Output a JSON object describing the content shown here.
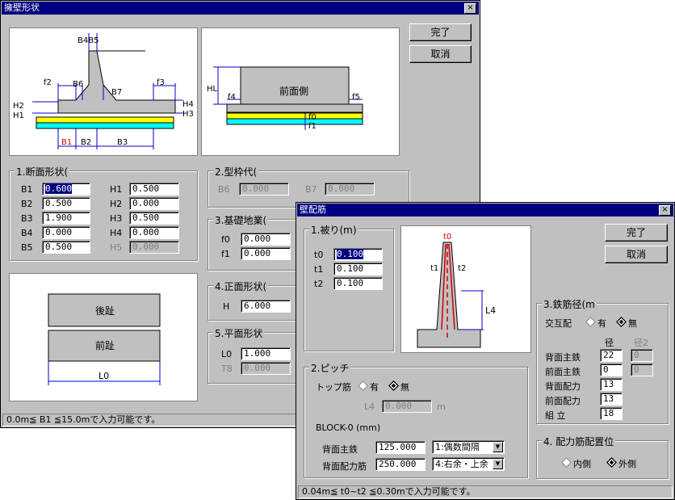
{
  "win1": {
    "title": "擁壁形状",
    "close": "×",
    "ok": "完了",
    "cancel": "取消",
    "diagram1": {
      "b4b5": "B4B5",
      "b6": "B6",
      "b7": "B7",
      "f2": "f2",
      "f3": "f3",
      "h2": "H2",
      "h1": "H1",
      "h4": "H4",
      "h3": "H3",
      "b1": "B1",
      "b2": "B2",
      "b3": "B3"
    },
    "diagram2": {
      "hl": "HL",
      "front": "前面側",
      "f4": "f4",
      "f5": "f5",
      "f0": "f0",
      "f1": "f1"
    },
    "g1": {
      "title": "1.断面形状(",
      "b1": {
        "label": "B1",
        "value": "0.600"
      },
      "h1": {
        "label": "H1",
        "value": "0.500"
      },
      "b2": {
        "label": "B2",
        "value": "0.500"
      },
      "h2": {
        "label": "H2",
        "value": "0.000"
      },
      "b3": {
        "label": "B3",
        "value": "1.900"
      },
      "h3": {
        "label": "H3",
        "value": "0.500"
      },
      "b4": {
        "label": "B4",
        "value": "0.000"
      },
      "h4": {
        "label": "H4",
        "value": "0.000"
      },
      "b5": {
        "label": "B5",
        "value": "0.500"
      },
      "h5": {
        "label": "H5",
        "value": "0.000"
      }
    },
    "g2": {
      "title": "2.型枠代(",
      "b6": {
        "label": "B6",
        "value": "0.000"
      },
      "b7": {
        "label": "B7",
        "value": "0.000"
      }
    },
    "g3": {
      "title": "3.基礎地業(",
      "f0": {
        "label": "f0",
        "value": "0.000"
      },
      "f1": {
        "label": "f1",
        "value": "0.000"
      }
    },
    "g4": {
      "title": "4.正面形状(",
      "h": {
        "label": "H",
        "value": "6.000"
      }
    },
    "g5": {
      "title": "5.平面形状",
      "l0": {
        "label": "L0",
        "value": "1.000"
      },
      "t8": {
        "label": "T8",
        "value": "0.000"
      }
    },
    "plan": {
      "back": "後趾",
      "front": "前趾",
      "l0": "L0"
    },
    "status": "0.0m≦ B1 ≦15.0mで入力可能です。"
  },
  "win2": {
    "title": "壁配筋",
    "close": "×",
    "ok": "完了",
    "cancel": "取消",
    "g1": {
      "title": "1.被り(m)",
      "t0": {
        "label": "t0",
        "value": "0.100"
      },
      "t1": {
        "label": "t1",
        "value": "0.100"
      },
      "t2": {
        "label": "t2",
        "value": "0.100"
      }
    },
    "diagram": {
      "t0": "t0",
      "t1": "t1",
      "t2": "t2",
      "l4": "L4"
    },
    "g2": {
      "title": "2.ピッチ",
      "top_bar": "トップ筋",
      "yes": "有",
      "no": "無",
      "l4": {
        "label": "L4",
        "value": "0.000",
        "unit": "m"
      },
      "block": "BLOCK-0 (mm)",
      "back_main": {
        "label": "背面主鉄",
        "value": "125.000",
        "option": "1:偶数間隔"
      },
      "back_dist": {
        "label": "背面配力筋",
        "value": "250.000",
        "option": "4:右余・上余"
      }
    },
    "g3": {
      "title": "3.鉄筋径(m",
      "alt": "交互配",
      "yes": "有",
      "no": "無",
      "col1": "径",
      "col2": "径2",
      "rows": [
        {
          "label": "背面主鉄",
          "v1": "22",
          "v2": "0"
        },
        {
          "label": "前面主鉄",
          "v1": "0",
          "v2": "0"
        },
        {
          "label": "背面配力",
          "v1": "13"
        },
        {
          "label": "前面配力",
          "v1": "13"
        },
        {
          "label": "組 立",
          "v1": "18"
        }
      ]
    },
    "g4": {
      "title": "4. 配力筋配置位",
      "inner": "内側",
      "outer": "外側"
    },
    "status": "0.04m≦ t0~t2 ≦0.30mで入力可能です。"
  },
  "colors": {
    "titlebar": "#000080",
    "face": "#c0c0c0",
    "yellow": "#ffff00",
    "cyan": "#00ffff",
    "rebar": "#cc0000",
    "dim_blue": "#0000cc"
  }
}
